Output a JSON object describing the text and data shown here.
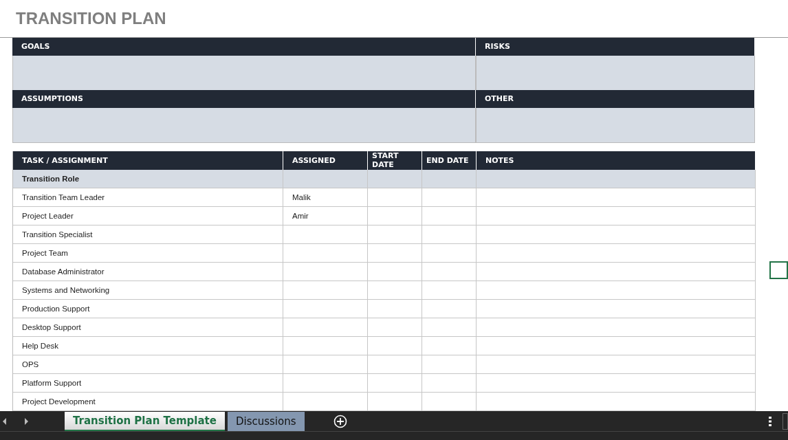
{
  "title": "TRANSITION PLAN",
  "sections": [
    {
      "label": "GOALS"
    },
    {
      "label": "RISKS"
    },
    {
      "label": "ASSUMPTIONS"
    },
    {
      "label": "OTHER"
    }
  ],
  "table": {
    "columns": [
      "TASK / ASSIGNMENT",
      "ASSIGNED",
      "START DATE",
      "END DATE",
      "NOTES"
    ],
    "rows": [
      {
        "kind": "group",
        "cells": [
          "Transition Role",
          "",
          "",
          "",
          ""
        ]
      },
      {
        "kind": "item",
        "cells": [
          "Transition Team Leader",
          "Malik",
          "",
          "",
          ""
        ]
      },
      {
        "kind": "item",
        "cells": [
          "Project Leader",
          "Amir",
          "",
          "",
          ""
        ]
      },
      {
        "kind": "item",
        "cells": [
          "Transition Specialist",
          "",
          "",
          "",
          ""
        ]
      },
      {
        "kind": "item",
        "cells": [
          "Project Team",
          "",
          "",
          "",
          ""
        ]
      },
      {
        "kind": "item",
        "cells": [
          "Database Administrator",
          "",
          "",
          "",
          ""
        ]
      },
      {
        "kind": "item",
        "cells": [
          "Systems and Networking",
          "",
          "",
          "",
          ""
        ]
      },
      {
        "kind": "item",
        "cells": [
          "Production Support",
          "",
          "",
          "",
          ""
        ]
      },
      {
        "kind": "item",
        "cells": [
          "Desktop Support",
          "",
          "",
          "",
          ""
        ]
      },
      {
        "kind": "item",
        "cells": [
          "Help Desk",
          "",
          "",
          "",
          ""
        ]
      },
      {
        "kind": "item",
        "cells": [
          "OPS",
          "",
          "",
          "",
          ""
        ]
      },
      {
        "kind": "item",
        "cells": [
          "Platform Support",
          "",
          "",
          "",
          ""
        ]
      },
      {
        "kind": "item",
        "cells": [
          "Project Development",
          "",
          "",
          "",
          ""
        ]
      }
    ]
  },
  "sheet_tabs": [
    {
      "label": "Transition Plan Template",
      "selected": true
    },
    {
      "label": "Discussions",
      "selected": false
    }
  ]
}
